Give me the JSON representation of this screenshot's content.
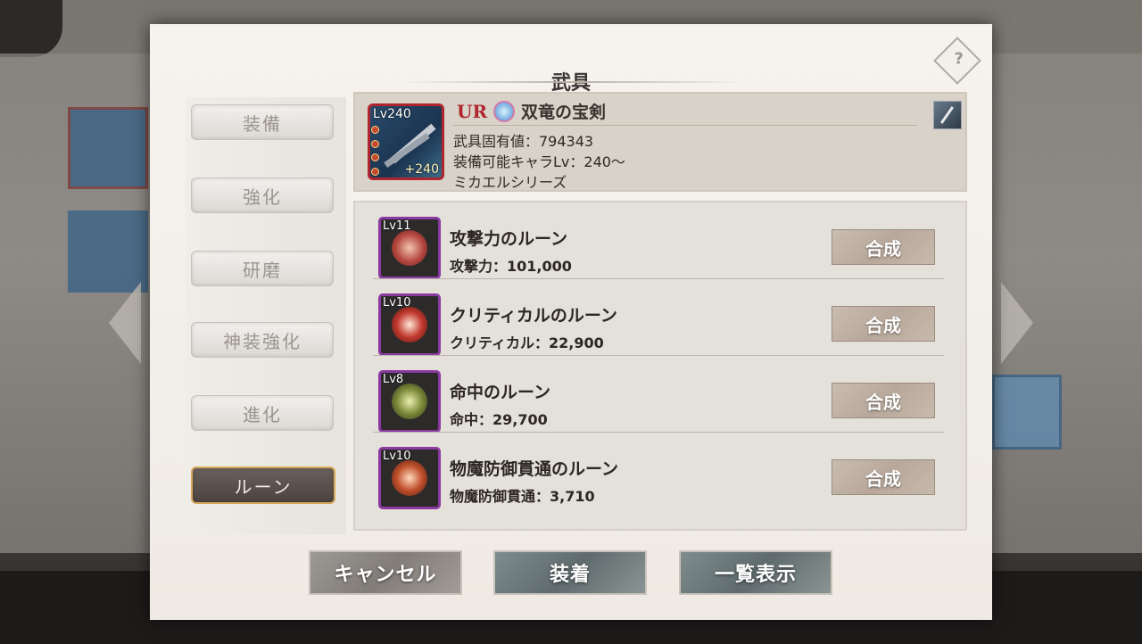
{
  "dialog": {
    "title": "武具",
    "help_icon": "?"
  },
  "tabs": [
    {
      "label": "装備",
      "active": false
    },
    {
      "label": "強化",
      "active": false
    },
    {
      "label": "研磨",
      "active": false
    },
    {
      "label": "神装強化",
      "active": false
    },
    {
      "label": "進化",
      "active": false
    },
    {
      "label": "ルーン",
      "active": true
    }
  ],
  "weapon": {
    "level": "Lv240",
    "plus": "+240",
    "rarity": "UR",
    "name": "双竜の宝剣",
    "unique_value": "武具固有値：794343",
    "equip_level": "装備可能キャラLv：240～",
    "series": "ミカエルシリーズ",
    "type_icon": "sword-icon"
  },
  "runes": [
    {
      "level": "Lv11",
      "name": "攻撃力のルーン",
      "stat": "攻撃力：101,000",
      "button": "合成",
      "color": "#b5473f"
    },
    {
      "level": "Lv10",
      "name": "クリティカルのルーン",
      "stat": "クリティカル：22,900",
      "button": "合成",
      "color": "#c23a2f"
    },
    {
      "level": "Lv8",
      "name": "命中のルーン",
      "stat": "命中：29,700",
      "button": "合成",
      "color": "#7d8a3a"
    },
    {
      "level": "Lv10",
      "name": "物魔防御貫通のルーン",
      "stat": "物魔防御貫通：3,710",
      "button": "合成",
      "color": "#c0502c"
    }
  ],
  "buttons": {
    "cancel": "キャンセル",
    "equip": "装着",
    "list": "一覧表示"
  }
}
